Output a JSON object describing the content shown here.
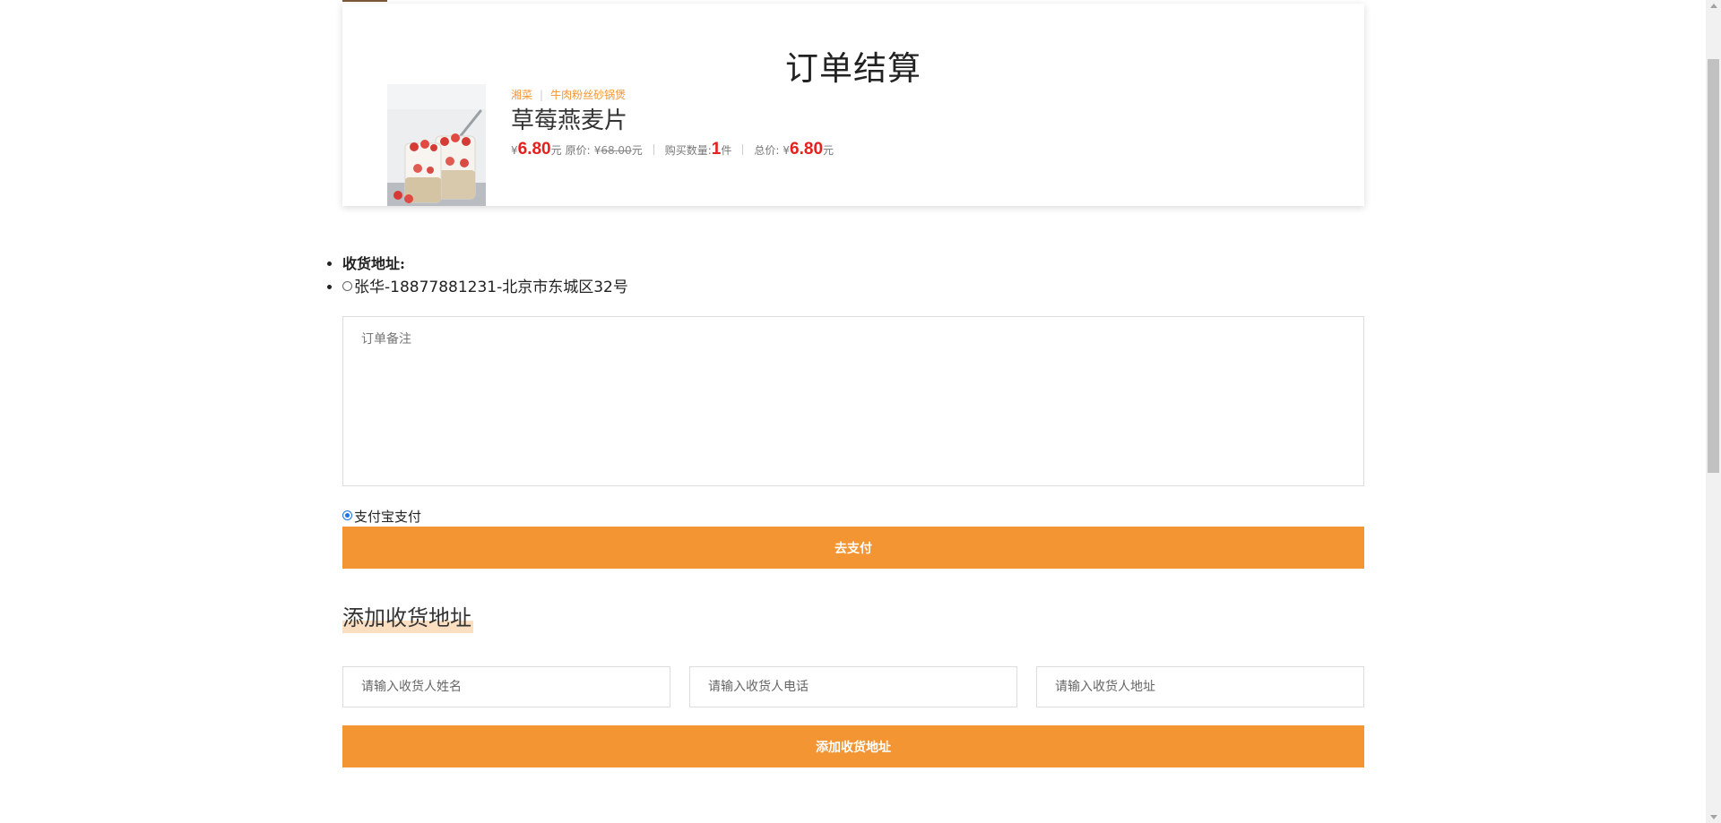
{
  "order": {
    "title": "订单结算",
    "product": {
      "image_icon": "strawberry-oatmeal-photo",
      "tags": [
        "湘菜",
        "牛肉粉丝砂锅煲"
      ],
      "name": "草莓燕麦片",
      "currency_symbol": "¥",
      "price": "6.80",
      "price_unit": "元",
      "original_price_label": "原价:",
      "original_price": "68.00",
      "original_price_unit": "元",
      "quantity_label": "购买数量:",
      "quantity": "1",
      "quantity_unit": "件",
      "total_label": "总价:",
      "total": "6.80",
      "total_unit": "元"
    }
  },
  "address": {
    "label": "收货地址:",
    "items": [
      "张华-18877881231-北京市东城区32号"
    ]
  },
  "remark": {
    "placeholder": "订单备注"
  },
  "payment": {
    "option_label": "支付宝支付",
    "button_label": "去支付"
  },
  "add_address": {
    "title": "添加收货地址",
    "name_placeholder": "请输入收货人姓名",
    "phone_placeholder": "请输入收货人电话",
    "address_placeholder": "请输入收货人地址",
    "button_label": "添加收货地址"
  },
  "colors": {
    "accent": "#f39532",
    "price_red": "#e4211c",
    "title_highlight": "#fbdfc0"
  }
}
